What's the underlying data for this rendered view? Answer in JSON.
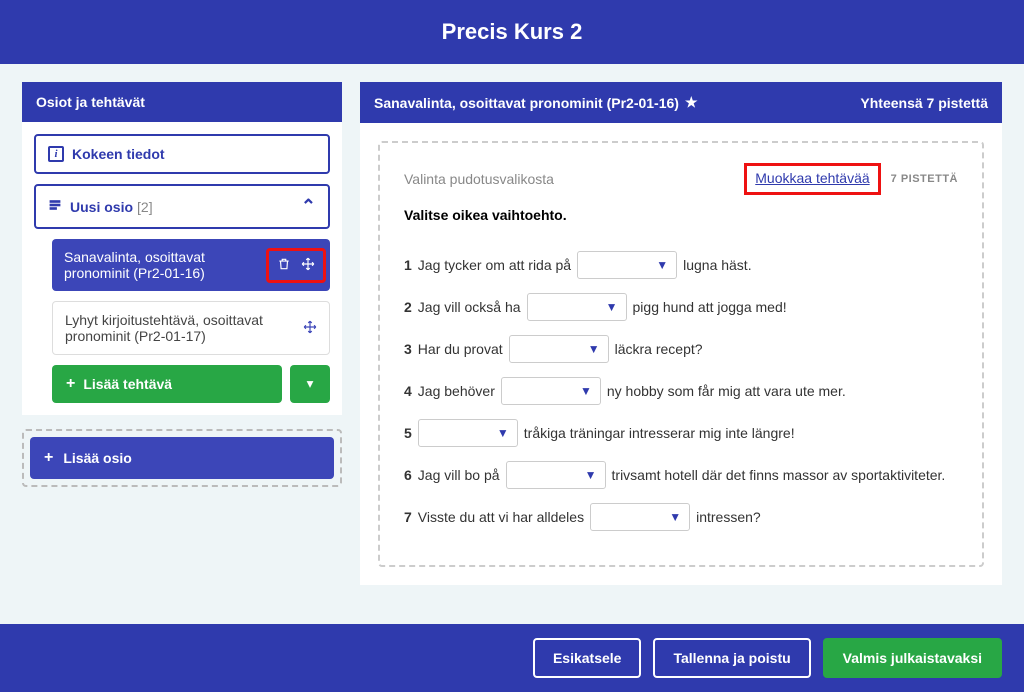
{
  "header": {
    "title": "Precis Kurs 2"
  },
  "sidebar": {
    "title": "Osiot ja tehtävät",
    "info_button": "Kokeen tiedot",
    "section": {
      "label": "Uusi osio",
      "count": "[2]"
    },
    "tasks": [
      {
        "label": "Sanavalinta, osoittavat pronominit (Pr2-01-16)"
      },
      {
        "label": "Lyhyt kirjoitustehtävä, osoittavat pronominit (Pr2-01-17)"
      }
    ],
    "add_task": "Lisää tehtävä",
    "add_section": "Lisää osio"
  },
  "main": {
    "title": "Sanavalinta, osoittavat pronominit (Pr2-01-16)",
    "total": "Yhteensä 7 pistettä",
    "task_type": "Valinta pudotusvalikosta",
    "edit_link": "Muokkaa tehtävää",
    "points": "7 PISTETTÄ",
    "instruction": "Valitse oikea vaihtoehto.",
    "questions": [
      {
        "n": "1",
        "pre": "Jag tycker om att rida på",
        "post": "lugna häst."
      },
      {
        "n": "2",
        "pre": "Jag vill också ha",
        "post": "pigg hund att jogga med!"
      },
      {
        "n": "3",
        "pre": "Har du provat",
        "post": "läckra recept?"
      },
      {
        "n": "4",
        "pre": "Jag behöver",
        "post": "ny hobby som får mig att vara ute mer."
      },
      {
        "n": "5",
        "pre": "",
        "post": "tråkiga träningar intresserar mig inte längre!"
      },
      {
        "n": "6",
        "pre": "Jag vill bo på",
        "post": "trivsamt hotell där det finns massor av sportaktiviteter."
      },
      {
        "n": "7",
        "pre": "Visste du att vi har alldeles",
        "post": "intressen?"
      }
    ]
  },
  "footer": {
    "preview": "Esikatsele",
    "save_exit": "Tallenna ja poistu",
    "publish": "Valmis julkaistavaksi"
  }
}
